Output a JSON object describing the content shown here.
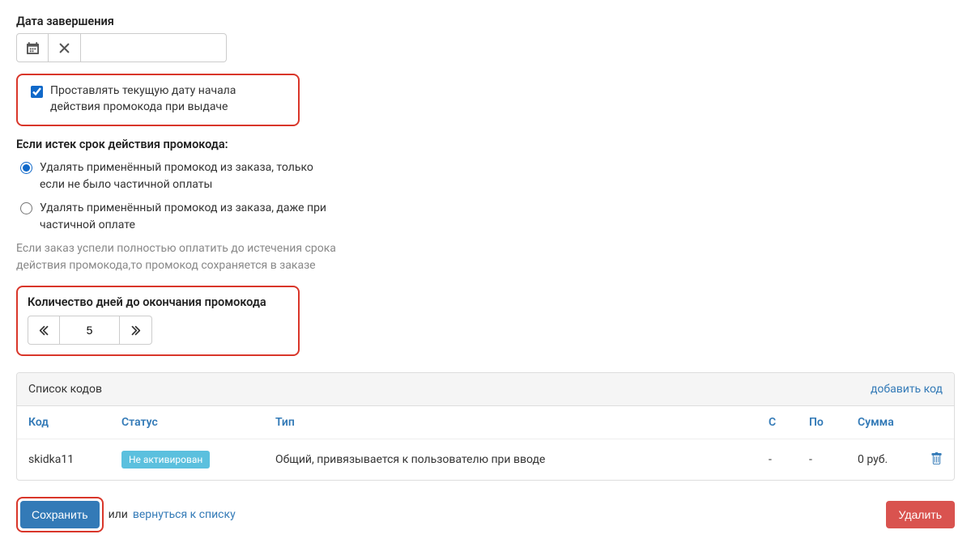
{
  "end_date": {
    "label": "Дата завершения",
    "value": ""
  },
  "checkbox": {
    "label": "Проставлять текущую дату начала действия промокода при выдаче",
    "checked": true
  },
  "expired": {
    "heading": "Если истек срок действия промокода:",
    "opt1": "Удалять применённый промокод из заказа, только если не было частичной оплаты",
    "opt2": "Удалять применённый промокод из заказа, даже при частичной оплате",
    "help": "Если заказ успели полностью оплатить до истечения срока действия промокода,то промокод сохраняется в заказе"
  },
  "days": {
    "label": "Количество дней до окончания промокода",
    "value": "5"
  },
  "codes": {
    "panel_title": "Список кодов",
    "add_label": "добавить код",
    "headers": {
      "code": "Код",
      "status": "Статус",
      "type": "Тип",
      "from": "С",
      "to": "По",
      "sum": "Сумма"
    },
    "row": {
      "code": "skidka11",
      "status": "Не активирован",
      "type": "Общий, привязывается к пользователю при вводе",
      "from": "-",
      "to": "-",
      "sum": "0 руб."
    }
  },
  "footer": {
    "save": "Сохранить",
    "or": "или",
    "back": "вернуться к списку",
    "delete": "Удалить"
  }
}
